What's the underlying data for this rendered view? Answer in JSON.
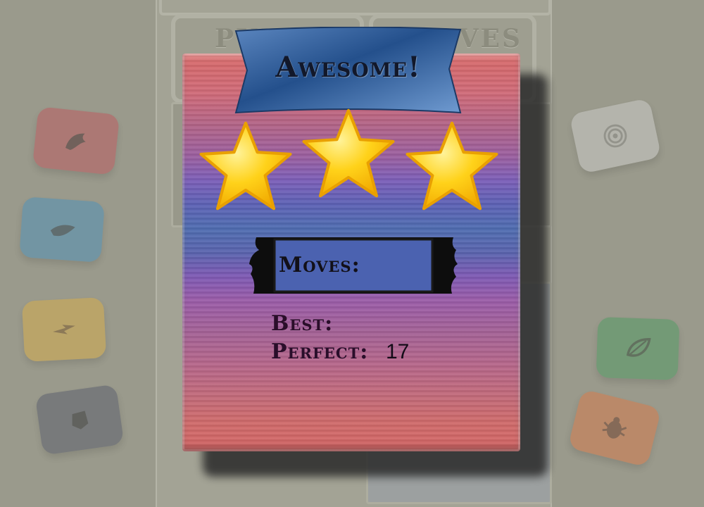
{
  "background": {
    "hud_left_label": "PUZZLE",
    "hud_right_label": "MOVES",
    "gems_left": [
      {
        "icon": "dragon-icon",
        "color": "#c74a55"
      },
      {
        "icon": "water-drop-icon",
        "color": "#3d8fc4"
      },
      {
        "icon": "lightning-icon",
        "color": "#e8b23b"
      },
      {
        "icon": "shadow-icon",
        "color": "#4a4f66"
      }
    ],
    "gems_right": [
      {
        "icon": "wind-swirl-icon",
        "color": "#d8d8d8"
      },
      {
        "icon": "leaf-icon",
        "color": "#3f9b5a"
      },
      {
        "icon": "bug-icon",
        "color": "#e8743a"
      }
    ]
  },
  "dialog": {
    "title": "Awesome!",
    "stars_earned": 3,
    "stars_total": 3,
    "moves_label": "Moves:",
    "moves_value": "",
    "best_label": "Best:",
    "best_value": "",
    "perfect_label": "Perfect:",
    "perfect_value": "17",
    "colors": {
      "banner": "#2f5f9c",
      "star_fill": "#ffd21a",
      "star_outline": "#f4b400",
      "text": "#1a1020"
    }
  }
}
